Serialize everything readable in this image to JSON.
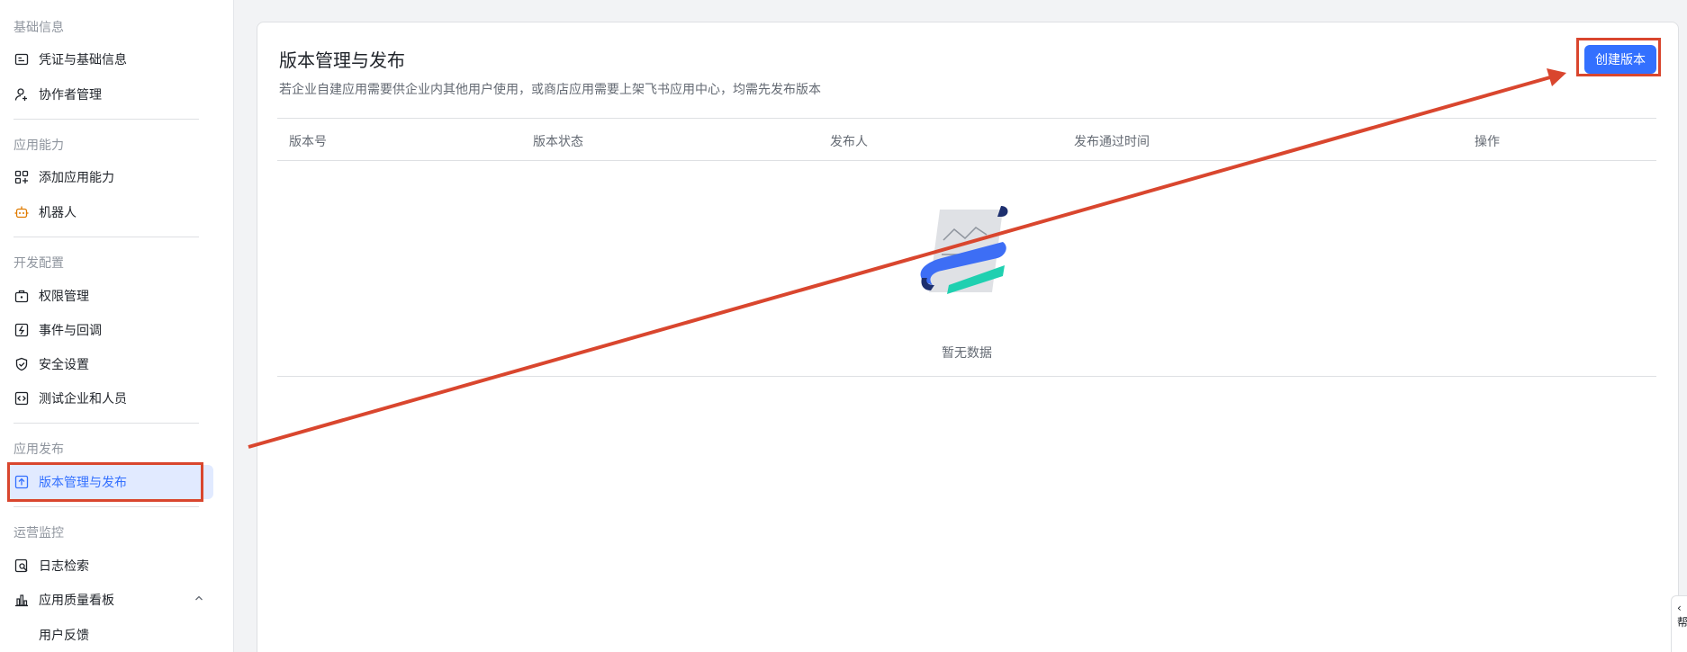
{
  "sidebar": {
    "groups": [
      {
        "title": "基础信息",
        "items": [
          "凭证与基础信息",
          "协作者管理"
        ]
      },
      {
        "title": "应用能力",
        "items": [
          "添加应用能力",
          "机器人"
        ]
      },
      {
        "title": "开发配置",
        "items": [
          "权限管理",
          "事件与回调",
          "安全设置",
          "测试企业和人员"
        ]
      },
      {
        "title": "应用发布",
        "items": [
          "版本管理与发布"
        ]
      },
      {
        "title": "运营监控",
        "items": [
          "日志检索",
          "应用质量看板"
        ],
        "sub_items": [
          "用户反馈"
        ]
      }
    ],
    "active_item": "版本管理与发布"
  },
  "main": {
    "title": "版本管理与发布",
    "description": "若企业自建应用需要供企业内其他用户使用，或商店应用需要上架飞书应用中心，均需先发布版本",
    "create_button": "创建版本",
    "table": {
      "columns": [
        "版本号",
        "版本状态",
        "发布人",
        "发布通过时间",
        "操作"
      ],
      "rows": [],
      "empty_text": "暂无数据"
    }
  },
  "edge_tab": {
    "glyph": "‹",
    "label": "帮"
  },
  "colors": {
    "accent": "#3370ff",
    "annotation": "#d9462e",
    "active_bg": "#e1eaff"
  },
  "icons": [
    "credential-icon",
    "user-add-icon",
    "grid-add-icon",
    "robot-icon",
    "briefcase-icon",
    "event-icon",
    "shield-check-icon",
    "code-icon",
    "upload-icon",
    "log-search-icon",
    "bar-chart-icon",
    "chevron-up-icon"
  ]
}
